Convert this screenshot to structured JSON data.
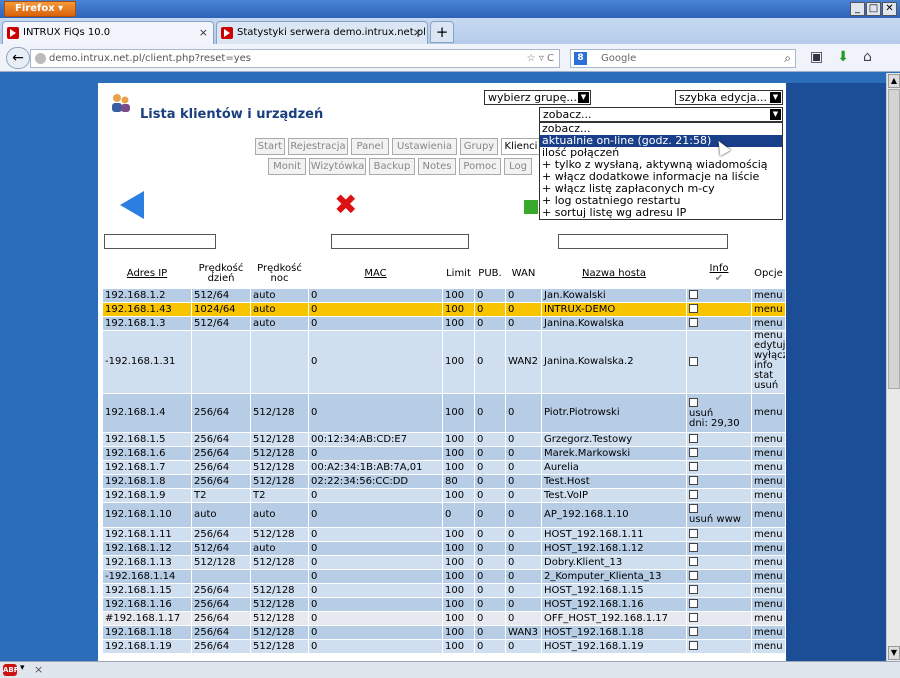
{
  "browser": {
    "app_button": "Firefox",
    "tabs": [
      {
        "label": "INTRUX FiQs 10.0"
      },
      {
        "label": "Statystyki serwera demo.intrux.net.pl"
      }
    ],
    "new_tab": "+",
    "url": "demo.intrux.net.pl/client.php?reset=yes",
    "search_placeholder": "Google",
    "search_engine_letter": "8"
  },
  "page": {
    "title": "Lista klientów i urządzeń",
    "select_group": "wybierz grupę...",
    "select_quick": "szybka edycja...",
    "select_view": "zobacz...",
    "view_options": [
      "zobacz...",
      "aktualnie on-line (godz. 21:58)",
      "ilość połączeń",
      "+ tylko z wysłaną, aktywną wiadomością",
      "+ włącz dodatkowe informacje na liście",
      "+ włącz listę zapłaconych m-cy",
      "+ log ostatniego restartu",
      "+ sortuj listę wg adresu IP"
    ],
    "nav_row1": [
      "Start",
      "Rejestracja",
      "Panel",
      "Ustawienia",
      "Grupy",
      "Klienci"
    ],
    "nav_row2": [
      "Monit",
      "Wizytówka",
      "Backup",
      "Notes",
      "Pomoc",
      "Log"
    ]
  },
  "table": {
    "headers": {
      "ip": "Adres IP",
      "speed_day": "Prędkość dzień",
      "speed_night": "Prędkość noc",
      "mac": "MAC",
      "limit": "Limit",
      "pub": "PUB.",
      "wan": "WAN",
      "host": "Nazwa hosta",
      "info": "Info",
      "options": "Opcje"
    },
    "rows": [
      {
        "ip": "192.168.1.2",
        "day": "512/64",
        "night": "auto",
        "mac": "0",
        "limit": "100",
        "pub": "0",
        "wan": "0",
        "host": "Jan.Kowalski",
        "info": "",
        "opt": "menu"
      },
      {
        "ip": "192.168.1.43",
        "day": "1024/64",
        "night": "auto",
        "mac": "0",
        "limit": "100",
        "pub": "0",
        "wan": "0",
        "host": "INTRUX-DEMO",
        "info": "",
        "opt": "menu"
      },
      {
        "ip": "192.168.1.3",
        "day": "512/64",
        "night": "auto",
        "mac": "0",
        "limit": "100",
        "pub": "0",
        "wan": "0",
        "host": "Janina.Kowalska",
        "info": "",
        "opt": "menu"
      },
      {
        "ip": "-192.168.1.31",
        "day": "",
        "night": "",
        "mac": "0",
        "limit": "100",
        "pub": "0",
        "wan": "WAN2",
        "host": "Janina.Kowalska.2",
        "info": "",
        "opt": "menu\nedytuj\nwyłącz\ninfo\nstat\nusuń"
      },
      {
        "ip": "192.168.1.4",
        "day": "256/64",
        "night": "512/128",
        "mac": "0",
        "limit": "100",
        "pub": "0",
        "wan": "0",
        "host": "Piotr.Piotrowski",
        "info": "usuń\ndni: 29,30",
        "opt": "menu"
      },
      {
        "ip": "192.168.1.5",
        "day": "256/64",
        "night": "512/128",
        "mac": "00:12:34:AB:CD:E7",
        "limit": "100",
        "pub": "0",
        "wan": "0",
        "host": "Grzegorz.Testowy",
        "info": "",
        "opt": "menu"
      },
      {
        "ip": "192.168.1.6",
        "day": "256/64",
        "night": "512/128",
        "mac": "0",
        "limit": "100",
        "pub": "0",
        "wan": "0",
        "host": "Marek.Markowski",
        "info": "",
        "opt": "menu"
      },
      {
        "ip": "192.168.1.7",
        "day": "256/64",
        "night": "512/128",
        "mac": "00:A2:34:1B:AB:7A,01",
        "limit": "100",
        "pub": "0",
        "wan": "0",
        "host": "Aurelia",
        "info": "",
        "opt": "menu"
      },
      {
        "ip": "192.168.1.8",
        "day": "256/64",
        "night": "512/128",
        "mac": "02:22:34:56:CC:DD",
        "limit": "80",
        "pub": "0",
        "wan": "0",
        "host": "Test.Host",
        "info": "",
        "opt": "menu"
      },
      {
        "ip": "192.168.1.9",
        "day": "T2",
        "night": "T2",
        "mac": "0",
        "limit": "100",
        "pub": "0",
        "wan": "0",
        "host": "Test.VoIP",
        "info": "",
        "opt": "menu"
      },
      {
        "ip": "192.168.1.10",
        "day": "auto",
        "night": "auto",
        "mac": "0",
        "limit": "0",
        "pub": "0",
        "wan": "0",
        "host": "AP_192.168.1.10",
        "info": "usuń www",
        "opt": "menu"
      },
      {
        "ip": "192.168.1.11",
        "day": "256/64",
        "night": "512/128",
        "mac": "0",
        "limit": "100",
        "pub": "0",
        "wan": "0",
        "host": "HOST_192.168.1.11",
        "info": "",
        "opt": "menu"
      },
      {
        "ip": "192.168.1.12",
        "day": "512/64",
        "night": "auto",
        "mac": "0",
        "limit": "100",
        "pub": "0",
        "wan": "0",
        "host": "HOST_192.168.1.12",
        "info": "",
        "opt": "menu"
      },
      {
        "ip": "192.168.1.13",
        "day": "512/128",
        "night": "512/128",
        "mac": "0",
        "limit": "100",
        "pub": "0",
        "wan": "0",
        "host": "Dobry.Klient_13",
        "info": "",
        "opt": "menu"
      },
      {
        "ip": "-192.168.1.14",
        "day": "",
        "night": "",
        "mac": "0",
        "limit": "100",
        "pub": "0",
        "wan": "0",
        "host": "2_Komputer_Klienta_13",
        "info": "",
        "opt": "menu"
      },
      {
        "ip": "192.168.1.15",
        "day": "256/64",
        "night": "512/128",
        "mac": "0",
        "limit": "100",
        "pub": "0",
        "wan": "0",
        "host": "HOST_192.168.1.15",
        "info": "",
        "opt": "menu"
      },
      {
        "ip": "192.168.1.16",
        "day": "256/64",
        "night": "512/128",
        "mac": "0",
        "limit": "100",
        "pub": "0",
        "wan": "0",
        "host": "HOST_192.168.1.16",
        "info": "",
        "opt": "menu"
      },
      {
        "ip": "#192.168.1.17",
        "day": "256/64",
        "night": "512/128",
        "mac": "0",
        "limit": "100",
        "pub": "0",
        "wan": "0",
        "host": "OFF_HOST_192.168.1.17",
        "info": "",
        "opt": "menu"
      },
      {
        "ip": "192.168.1.18",
        "day": "256/64",
        "night": "512/128",
        "mac": "0",
        "limit": "100",
        "pub": "0",
        "wan": "WAN3",
        "host": "HOST_192.168.1.18",
        "info": "",
        "opt": "menu"
      },
      {
        "ip": "192.168.1.19",
        "day": "256/64",
        "night": "512/128",
        "mac": "0",
        "limit": "100",
        "pub": "0",
        "wan": "0",
        "host": "HOST_192.168.1.19",
        "info": "",
        "opt": "menu"
      }
    ]
  },
  "colors": {
    "row_highlight": "#f8c400",
    "row_bg": "#b7cde6",
    "row_alt": "#cfdff0",
    "page_bg": "#2c6dba"
  },
  "statusbar": {
    "addon_label": "ABP",
    "close": "×"
  }
}
